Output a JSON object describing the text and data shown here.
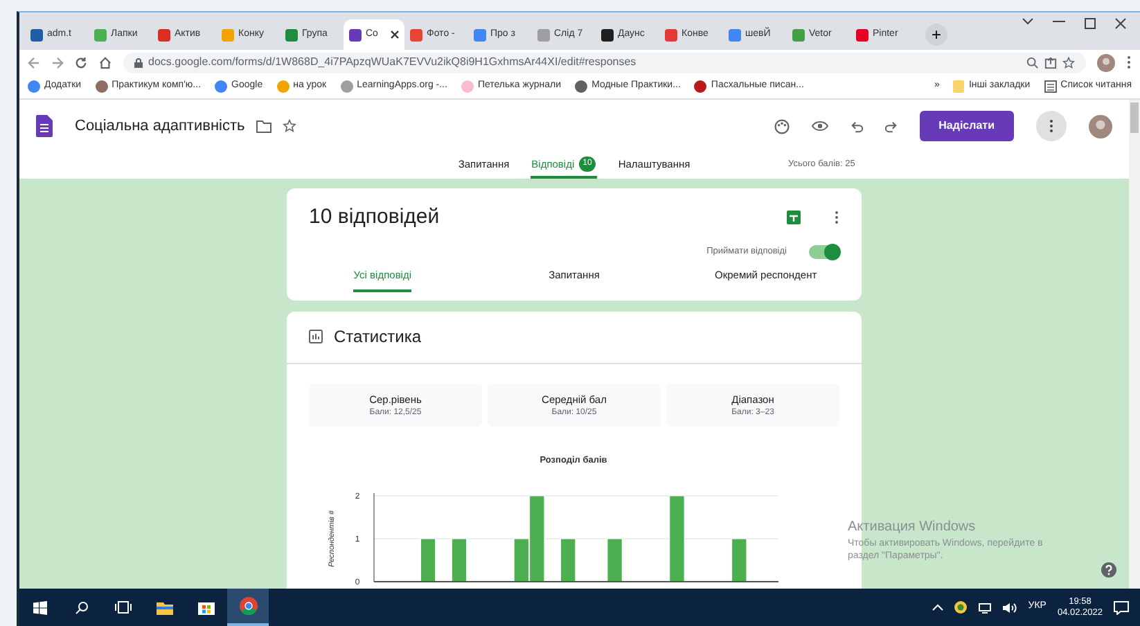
{
  "browser": {
    "tabs": [
      {
        "title": "adm.t",
        "color": "#1f5fa8",
        "selected": false
      },
      {
        "title": "Лапки",
        "color": "#4caf50",
        "selected": false
      },
      {
        "title": "Актив",
        "color": "#d93025",
        "selected": false
      },
      {
        "title": "Конку",
        "color": "#f4a400",
        "selected": false
      },
      {
        "title": "Група",
        "color": "#1e8e3e",
        "selected": false
      },
      {
        "title": "Со",
        "color": "#673ab7",
        "selected": true
      },
      {
        "title": "Фото -",
        "color": "#ea4335",
        "selected": false
      },
      {
        "title": "Про з",
        "color": "#4285f4",
        "selected": false
      },
      {
        "title": "Слід 7",
        "color": "#9e9e9e",
        "selected": false
      },
      {
        "title": "Даунс",
        "color": "#202020",
        "selected": false
      },
      {
        "title": "Конве",
        "color": "#e53935",
        "selected": false
      },
      {
        "title": "шевЙ",
        "color": "#4285f4",
        "selected": false
      },
      {
        "title": "Vetor",
        "color": "#43a047",
        "selected": false
      },
      {
        "title": "Pinter",
        "color": "#e60023",
        "selected": false
      }
    ],
    "new_tab": "+",
    "address": "docs.google.com/forms/d/1W868D_4i7PApzqWUaK7EVVu2ikQ8i9H1GxhmsAr44XI/edit#responses",
    "bookmarks": [
      {
        "title": "Додатки",
        "color": "#4285f4"
      },
      {
        "title": "Практикум комп'ю...",
        "color": "#8d6e63"
      },
      {
        "title": "Google",
        "color": "#4285f4"
      },
      {
        "title": "на урок",
        "color": "#f4a400"
      },
      {
        "title": "LearningApps.org -...",
        "color": "#9e9e9e"
      },
      {
        "title": "Петелька журнали",
        "color": "#f8bbd0"
      },
      {
        "title": "Модные Практики...",
        "color": "#616161"
      },
      {
        "title": "Пасхальные писан...",
        "color": "#b71c1c"
      }
    ],
    "more": "»",
    "other_bookmarks": "Інші закладки",
    "reading_list": "Список читання"
  },
  "form": {
    "title": "Соціальна адаптивність",
    "send": "Надіслати",
    "nav": [
      {
        "label": "Запитання",
        "selected": false
      },
      {
        "label": "Відповіді",
        "badge": "10",
        "selected": true
      },
      {
        "label": "Налаштування",
        "selected": false
      }
    ],
    "total": "Усього балів: 25"
  },
  "responses": {
    "heading": "10 відповідей",
    "accept_label": "Приймати відповіді",
    "accepting": true,
    "tabs": [
      {
        "label": "Усі відповіді",
        "selected": true
      },
      {
        "label": "Запитання",
        "selected": false
      },
      {
        "label": "Окремий респондент",
        "selected": false
      }
    ]
  },
  "statistics": {
    "title": "Статистика",
    "boxes": [
      {
        "title": "Сер.рівень",
        "detail": "Бали: 12,5/25"
      },
      {
        "title": "Середній бал",
        "detail": "Бали: 10/25"
      },
      {
        "title": "Діапазон",
        "detail": "Бали: 3–23"
      }
    ],
    "chart_data": {
      "type": "bar",
      "title": "Розподіл балів",
      "ylabel": "Респондентів #",
      "categories": [
        null,
        null,
        null,
        null,
        null,
        null,
        null,
        null,
        null,
        null,
        null,
        null,
        null,
        null,
        null,
        null,
        null,
        null,
        null,
        null,
        null,
        null,
        null,
        null,
        null,
        null
      ],
      "values": [
        0,
        0,
        0,
        1,
        0,
        1,
        0,
        0,
        0,
        1,
        2,
        0,
        1,
        0,
        0,
        1,
        0,
        0,
        0,
        2,
        0,
        0,
        0,
        1,
        0,
        0
      ],
      "ylim": [
        0,
        2
      ],
      "yticks": [
        0,
        1,
        2
      ]
    }
  },
  "activation": {
    "title": "Активация Windows",
    "lines": [
      "Чтобы активировать Windows, перейдите в",
      "раздел \"Параметры\"."
    ]
  },
  "taskbar": {
    "language": "УКР",
    "time": "19:58",
    "date": "04.02.2022"
  }
}
